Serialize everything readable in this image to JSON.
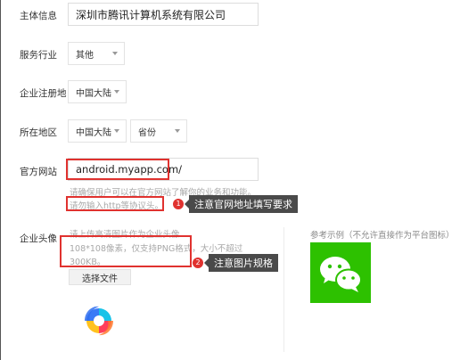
{
  "form": {
    "entity": {
      "label": "主体信息",
      "value": "深圳市腾讯计算机系统有限公司"
    },
    "industry": {
      "label": "服务行业",
      "value": "其他"
    },
    "registration": {
      "label": "企业注册地",
      "value": "中国大陆"
    },
    "region": {
      "label": "所在地区",
      "country": "中国大陆",
      "province": "省份"
    },
    "website": {
      "label": "官方网站",
      "value": "android.myapp.com/",
      "hint1": "请确保用户可以在官方网站了解你的业务和功能。",
      "hint2": "请勿输入http等协议头。",
      "annotation_num": "1",
      "annotation": "注意官网地址填写要求"
    },
    "avatar": {
      "label": "企业头像",
      "hint1": "请上传高清图片作为企业头像",
      "hint2": "108*108像素，仅支持PNG格式，大小不超过",
      "hint3": "300KB。",
      "annotation_num": "2",
      "annotation": "注意图片规格",
      "button": "选择文件",
      "reference_label": "参考示例（不允许直接作为平台图标）",
      "preview_icon": "app-store-logo-icon",
      "example_icon": "wechat-logo-icon"
    }
  },
  "colors": {
    "annotation_red": "#e0322f",
    "tooltip_bg": "#4a4a4a",
    "wechat_green": "#2dc100"
  }
}
